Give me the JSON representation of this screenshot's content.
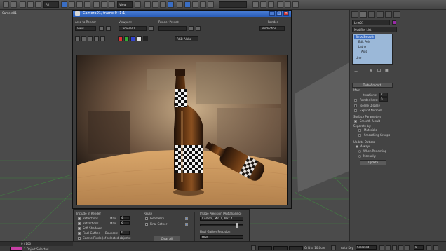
{
  "viewport": {
    "label": "Camera01"
  },
  "toolbar": {
    "selection_filter": "All",
    "view_combo": "View"
  },
  "render_window": {
    "title": "Camera01, frame 0 (1:1)",
    "area_to_render_label": "Area to Render",
    "area_to_render_value": "View",
    "viewport_label": "Viewport:",
    "viewport_value": "Camera01",
    "render_preset_label": "Render Preset:",
    "render_preset_value": "",
    "render_label": "Render",
    "render_mode": "Production",
    "channel_value": "RGB Alpha"
  },
  "command_panel": {
    "object_name": "Line01",
    "modifier_list": "Modifier List",
    "stack_items": [
      "TurboSmooth",
      "Edit Poly",
      "Lathe",
      "Axis",
      "Line"
    ],
    "rollout_turbosmooth": "TurboSmooth",
    "main_label": "Main",
    "iterations_label": "Iterations:",
    "iterations_value": "2",
    "render_iters_label": "Render Iters:",
    "render_iters_value": "0",
    "isoline_display": "Isoline Display",
    "explicit_normals": "Explicit Normals",
    "surface_parameters": "Surface Parameters",
    "smooth_result": "Smooth Result",
    "separate_by": "Separate by:",
    "materials": "Materials",
    "smoothing_groups": "Smoothing Groups",
    "update_options": "Update Options",
    "always": "Always",
    "when_rendering": "When Rendering",
    "manually": "Manually",
    "update_button": "Update"
  },
  "render_settings": {
    "include_in_render": "Include in Render",
    "reflections": "Reflections",
    "refractions": "Refractions",
    "soft_shadows": "Soft Shadows",
    "final_gather": "Final Gather",
    "max_label": "Max.",
    "reflections_max": "4",
    "refractions_max": "6",
    "bounces_label": "Bounces:",
    "bounces_value": "0",
    "coarse_pixels": "Coarse Pixels (of selected objects)",
    "reuse_label": "Reuse",
    "geometry": "Geometry",
    "final_gather_reuse": "Final Gather",
    "clear_all_button": "Clear All",
    "image_precision_label": "Image Precision (Antialiasing)",
    "image_precision_value": "Custom, Min 1, Max 4",
    "fg_precision_label": "Final Gather Precision",
    "fg_precision_value": "High"
  },
  "status_bar": {
    "frame_counter": "0 / 100",
    "selection_status": "1 Object Selected",
    "grid_status": "Grid = 10.0cm",
    "auto_key": "Auto Key",
    "key_mode": "Selected",
    "frame_value": "0"
  },
  "colors": {
    "title_blue": "#2a5db8",
    "close_red": "#c9302c",
    "stack_blue": "#9bb8d8",
    "object_color": "#9a2aa8",
    "grid_green": "#3f8f3f"
  }
}
